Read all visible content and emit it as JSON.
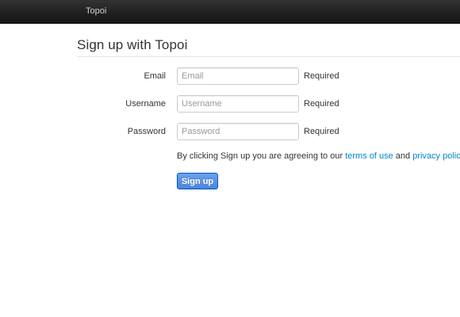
{
  "navbar": {
    "brand": "Topoi"
  },
  "page": {
    "title": "Sign up with Topoi"
  },
  "form": {
    "fields": [
      {
        "label": "Email",
        "placeholder": "Email",
        "value": "",
        "help": "Required"
      },
      {
        "label": "Username",
        "placeholder": "Username",
        "value": "",
        "help": "Required"
      },
      {
        "label": "Password",
        "placeholder": "Password",
        "value": "",
        "help": "Required"
      }
    ],
    "agreement": {
      "prefix": "By clicking Sign up you are agreeing to our ",
      "terms_link": "terms of use",
      "middle": " and ",
      "privacy_link": "privacy policy",
      "suffix": "."
    },
    "submit_label": "Sign up"
  },
  "colors": {
    "navbar_bg": "#1b1b1b",
    "link": "#0088cc",
    "button": "#5a93e4"
  }
}
